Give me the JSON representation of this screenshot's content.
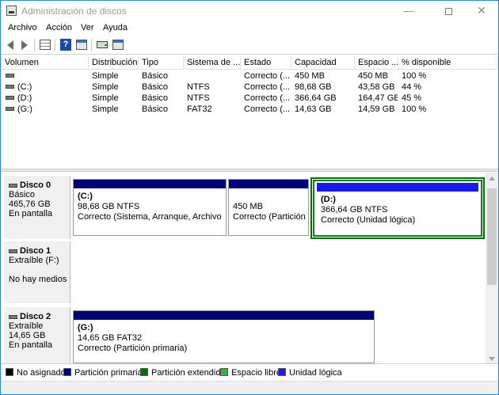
{
  "window": {
    "title": "Administración de discos"
  },
  "menu": [
    "Archivo",
    "Acción",
    "Ver",
    "Ayuda"
  ],
  "toolbar": {
    "icons": [
      "back-arrow-icon",
      "forward-arrow-icon",
      "properties-grid-icon",
      "help-icon",
      "console-window-icon",
      "connect-drive-icon",
      "disk-view-icon"
    ]
  },
  "volume_list": {
    "columns": [
      "Volumen",
      "Distribución",
      "Tipo",
      "Sistema de ...",
      "Estado",
      "Capacidad",
      "Espacio ...",
      "% disponible"
    ],
    "rows": [
      {
        "volume": "",
        "layout": "Simple",
        "type": "Básico",
        "fs": "",
        "status": "Correcto (...",
        "capacity": "450 MB",
        "free": "450 MB",
        "pct": "100 %"
      },
      {
        "volume": "(C:)",
        "layout": "Simple",
        "type": "Básico",
        "fs": "NTFS",
        "status": "Correcto (...",
        "capacity": "98,68 GB",
        "free": "43,58 GB",
        "pct": "44 %"
      },
      {
        "volume": "(D:)",
        "layout": "Simple",
        "type": "Básico",
        "fs": "NTFS",
        "status": "Correcto (...",
        "capacity": "366,64 GB",
        "free": "164,47 GB",
        "pct": "45 %"
      },
      {
        "volume": "(G:)",
        "layout": "Simple",
        "type": "Básico",
        "fs": "FAT32",
        "status": "Correcto (...",
        "capacity": "14,63 GB",
        "free": "14,59 GB",
        "pct": "100 %"
      }
    ]
  },
  "disks": [
    {
      "name": "Disco 0",
      "kind": "Básico",
      "size": "465,76 GB",
      "state": "En pantalla",
      "partitions": [
        {
          "name": "(C:)",
          "detail": "98,68 GB NTFS",
          "status": "Correcto (Sistema, Arranque, Archivo de p"
        },
        {
          "name": "",
          "detail": "450 MB",
          "status": "Correcto (Partición d"
        },
        {
          "name": "(D:)",
          "detail": "366,64 GB NTFS",
          "status": "Correcto (Unidad lógica)"
        }
      ]
    },
    {
      "name": "Disco 1",
      "kind": "Extraíble (F:)",
      "size": "",
      "state": "No hay medios",
      "partitions": []
    },
    {
      "name": "Disco 2",
      "kind": "Extraíble",
      "size": "14,65 GB",
      "state": "En pantalla",
      "partitions": [
        {
          "name": "(G:)",
          "detail": "14,65 GB FAT32",
          "status": "Correcto (Partición primaria)"
        }
      ]
    }
  ],
  "legend": [
    {
      "label": "No asignado",
      "color": "#000000"
    },
    {
      "label": "Partición primaria",
      "color": "#00007a"
    },
    {
      "label": "Partición extendida",
      "color": "#007000"
    },
    {
      "label": "Espacio libre",
      "color": "#3cb043"
    },
    {
      "label": "Unidad lógica",
      "color": "#1818f0"
    }
  ]
}
